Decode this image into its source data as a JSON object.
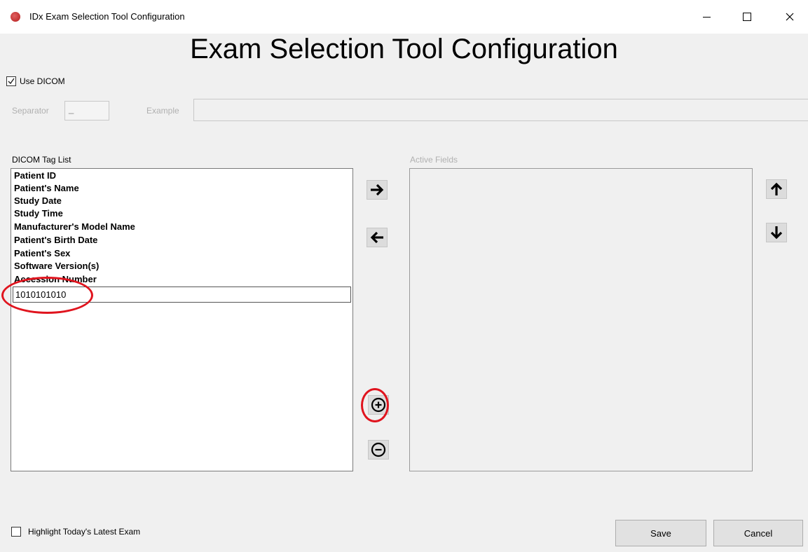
{
  "window": {
    "title": "IDx Exam Selection Tool Configuration",
    "minimize_icon": "minimize-icon",
    "maximize_icon": "maximize-icon",
    "close_icon": "close-icon"
  },
  "header": {
    "title": "Exam Selection Tool Configuration"
  },
  "use_dicom": {
    "label": "Use DICOM",
    "checked": true
  },
  "separator": {
    "label": "Separator",
    "value": "_"
  },
  "example": {
    "label": "Example",
    "value": ""
  },
  "tag_list": {
    "label": "DICOM Tag List",
    "items": [
      "Patient ID",
      "Patient's Name",
      "Study Date",
      "Study Time",
      "Manufacturer's Model Name",
      "Patient's Birth Date",
      "Patient's Sex",
      "Software Version(s)",
      "Accession Number"
    ],
    "edit_value": "1010101010"
  },
  "active_fields": {
    "label": "Active Fields",
    "items": []
  },
  "icons": {
    "move_right": "arrow-right-icon",
    "move_left": "arrow-left-icon",
    "move_up": "arrow-up-icon",
    "move_down": "arrow-down-icon",
    "add": "plus-circle-icon",
    "remove": "minus-circle-icon"
  },
  "highlight_latest": {
    "label": "Highlight Today's Latest Exam",
    "checked": false
  },
  "buttons": {
    "save": "Save",
    "cancel": "Cancel"
  },
  "colors": {
    "annotation": "#e0141e",
    "app_icon": "#c0292c"
  }
}
